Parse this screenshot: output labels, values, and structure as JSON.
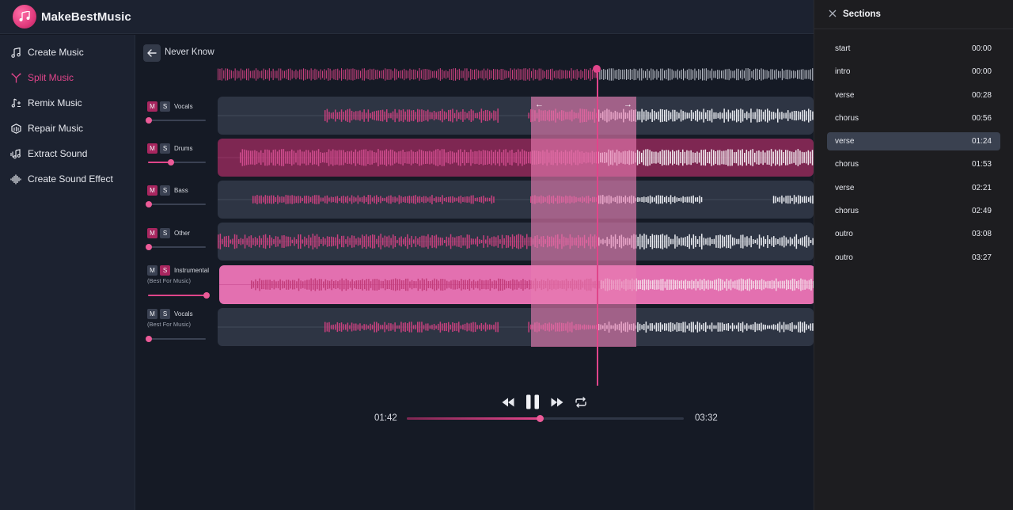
{
  "app": {
    "name": "MakeBestMusic"
  },
  "sidebar": {
    "items": [
      {
        "label": "Create Music",
        "icon": "music-notes-icon",
        "active": false
      },
      {
        "label": "Split Music",
        "icon": "split-icon",
        "active": true
      },
      {
        "label": "Remix Music",
        "icon": "remix-icon",
        "active": false
      },
      {
        "label": "Repair Music",
        "icon": "repair-icon",
        "active": false
      },
      {
        "label": "Extract Sound",
        "icon": "extract-icon",
        "active": false
      },
      {
        "label": "Create Sound Effect",
        "icon": "waveform-icon",
        "active": false
      }
    ]
  },
  "editor": {
    "song_title": "Never Know",
    "tracks": [
      {
        "m": "M",
        "s": "S",
        "name": "Vocals",
        "sub": "",
        "volume": 0.0,
        "solo": false
      },
      {
        "m": "M",
        "s": "S",
        "name": "Drums",
        "sub": "",
        "volume": 0.4,
        "solo": false
      },
      {
        "m": "M",
        "s": "S",
        "name": "Bass",
        "sub": "",
        "volume": 0.0,
        "solo": false
      },
      {
        "m": "M",
        "s": "S",
        "name": "Other",
        "sub": "",
        "volume": 0.0,
        "solo": false
      },
      {
        "m": "M",
        "s": "S",
        "name": "Instrumental",
        "sub": "(Best For Music)",
        "volume": 1.0,
        "solo": true
      },
      {
        "m": "M",
        "s": "S",
        "name": "Vocals",
        "sub": "(Best For Music)",
        "volume": 0.0,
        "solo": false
      }
    ],
    "selection_arrows": {
      "left": "←",
      "right": "→"
    }
  },
  "player": {
    "current_time": "01:42",
    "total_time": "03:32",
    "progress": 0.48,
    "state": "playing"
  },
  "panel": {
    "title": "Sections",
    "sections": [
      {
        "name": "start",
        "time": "00:00",
        "active": false
      },
      {
        "name": "intro",
        "time": "00:00",
        "active": false
      },
      {
        "name": "verse",
        "time": "00:28",
        "active": false
      },
      {
        "name": "chorus",
        "time": "00:56",
        "active": false
      },
      {
        "name": "verse",
        "time": "01:24",
        "active": true
      },
      {
        "name": "chorus",
        "time": "01:53",
        "active": false
      },
      {
        "name": "verse",
        "time": "02:21",
        "active": false
      },
      {
        "name": "chorus",
        "time": "02:49",
        "active": false
      },
      {
        "name": "outro",
        "time": "03:08",
        "active": false
      },
      {
        "name": "outro",
        "time": "03:27",
        "active": false
      }
    ]
  },
  "colors": {
    "accent": "#e0458a",
    "bg": "#141823",
    "panel": "#1d1d20"
  }
}
